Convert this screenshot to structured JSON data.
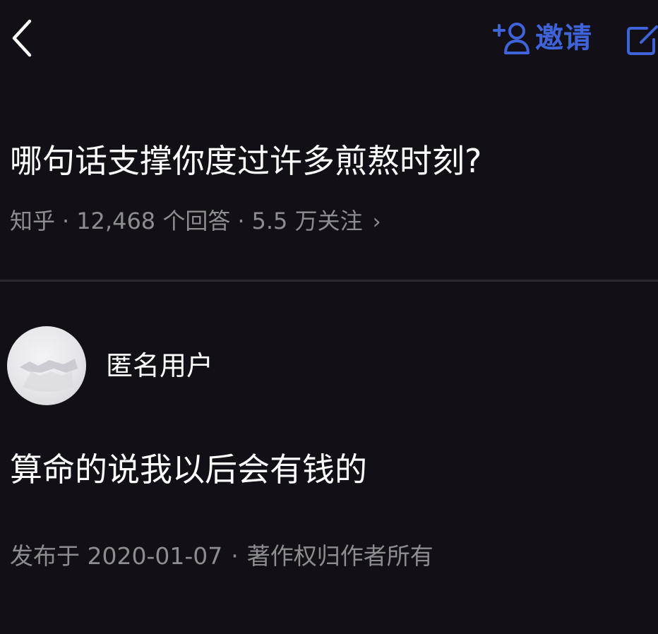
{
  "nav": {
    "back_icon": "chevron-left-icon",
    "invite_icon": "add-person-icon",
    "invite_label": "邀请",
    "edit_icon": "edit-icon",
    "accent_color": "#3f63d9"
  },
  "question": {
    "title": "哪句话支撑你度过许多煎熬时刻?",
    "source": "知乎",
    "separator": "·",
    "answers_count": "12,468 个回答",
    "followers": "5.5 万关注",
    "more_icon": "chevron-right-icon"
  },
  "answer": {
    "author": "匿名用户",
    "avatar_icon": "anonymous-avatar",
    "content": "算命的说我以后会有钱的",
    "published": "发布于 2020-01-07",
    "copyright": "著作权归作者所有"
  },
  "colors": {
    "background": "#121016",
    "text_primary": "#ffffff",
    "text_secondary": "#8d8c91",
    "divider": "#2a2930"
  }
}
